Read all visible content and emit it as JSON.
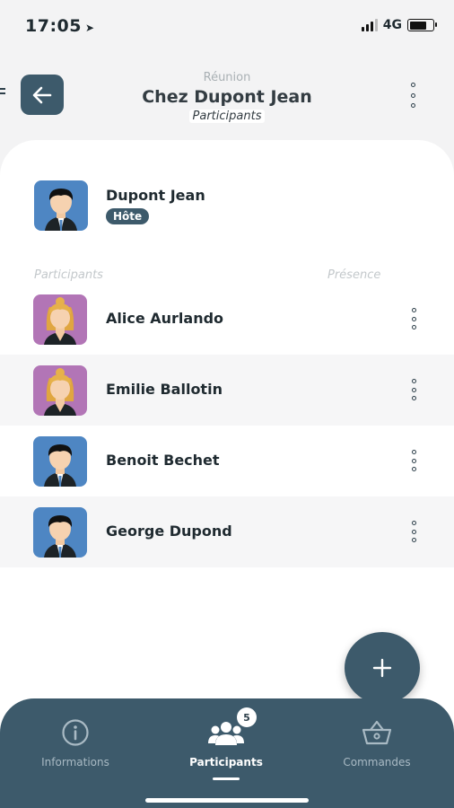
{
  "status": {
    "time": "17:05",
    "location_icon": "location-arrow-icon",
    "network": "4G"
  },
  "header": {
    "subtitle": "Réunion",
    "title": "Chez Dupont Jean",
    "tag": "Participants"
  },
  "host": {
    "name": "Dupont Jean",
    "badge": "Hôte",
    "avatar": "male"
  },
  "columns": {
    "participants": "Participants",
    "presence": "Présence"
  },
  "participants": [
    {
      "name": "Alice Aurlando",
      "avatar": "female"
    },
    {
      "name": "Emilie Ballotin",
      "avatar": "female"
    },
    {
      "name": "Benoit Bechet",
      "avatar": "male"
    },
    {
      "name": "George Dupond",
      "avatar": "male"
    }
  ],
  "fab": {
    "icon": "plus-icon"
  },
  "tabs": [
    {
      "label": "Informations",
      "icon": "info-icon",
      "active": false
    },
    {
      "label": "Participants",
      "icon": "users-icon",
      "active": true,
      "badge": "5"
    },
    {
      "label": "Commandes",
      "icon": "basket-icon",
      "active": false
    }
  ],
  "colors": {
    "primary": "#3d5a6b",
    "male_bg": "#4e86c3",
    "female_bg": "#b275b6"
  }
}
